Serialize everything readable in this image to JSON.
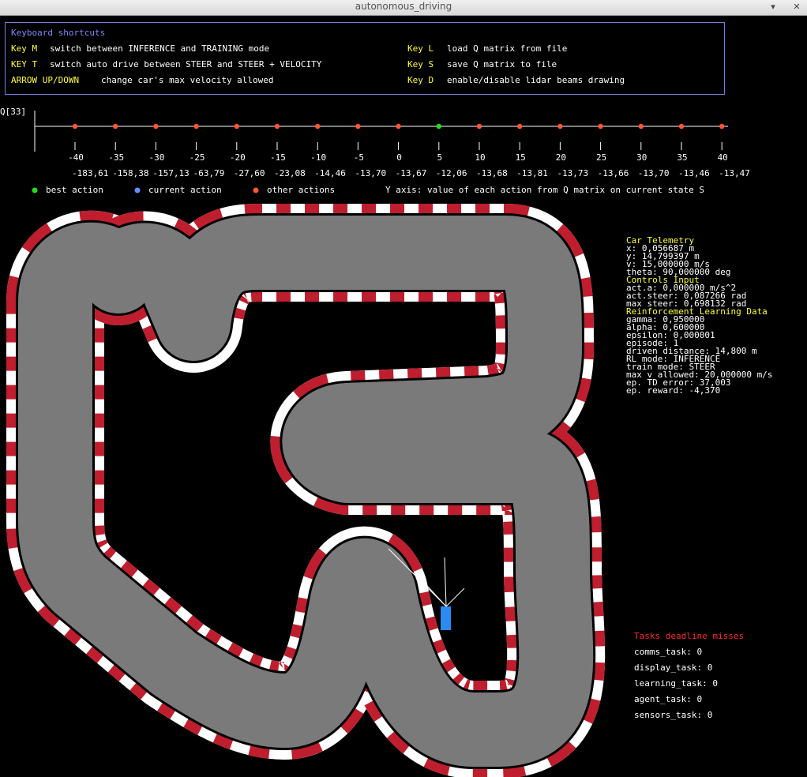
{
  "window": {
    "title": "autonomous_driving"
  },
  "shortcuts": {
    "header": "Keyboard shortcuts",
    "items": [
      {
        "key": "Key M",
        "desc": "switch between INFERENCE and TRAINING mode"
      },
      {
        "key": "KEY T",
        "desc": "switch auto drive between STEER and STEER + VELOCITY"
      },
      {
        "key": "ARROW UP/DOWN",
        "desc": "change car's max velocity allowed"
      },
      {
        "key": "Key L",
        "desc": "load Q matrix from file"
      },
      {
        "key": "Key S",
        "desc": "save Q matrix to file"
      },
      {
        "key": "Key D",
        "desc": "enable/disable lidar beams drawing"
      }
    ]
  },
  "qplot": {
    "label": "Q[33]",
    "actions": [
      "-40",
      "-35",
      "-30",
      "-25",
      "-20",
      "-15",
      "-10",
      "-5",
      "0",
      "5",
      "10",
      "15",
      "20",
      "25",
      "30",
      "35",
      "40"
    ],
    "values": [
      "-183,61",
      "-158,38",
      "-157,13",
      "-63,79",
      "-27,60",
      "-23,08",
      "-14,46",
      "-13,70",
      "-13,67",
      "-12,06",
      "-13,68",
      "-13,81",
      "-13,73",
      "-13,66",
      "-13,70",
      "-13,46",
      "-13,47"
    ],
    "best_index": 9,
    "legend": {
      "best": "best action",
      "current": "current action",
      "other": "other actions",
      "yaxis": "Y axis: value of each action from Q matrix on current state S"
    },
    "colors": {
      "best": "#22dd22",
      "current": "#6a8cff",
      "other": "#ff5533"
    }
  },
  "telemetry": {
    "car_header": "Car Telemetry",
    "car": [
      "x: 0,056687 m",
      "y: 14,799397 m",
      "v: 15,000000 m/s",
      "theta: 90,000000 deg"
    ],
    "controls_header": "Controls Input",
    "controls": [
      "act.a: 0,000000 m/s^2",
      "act.steer: 0,087266 rad",
      "max steer: 0,698132 rad"
    ],
    "rl_header": "Reinforcement Learning Data",
    "rl": [
      "gamma: 0,950000",
      "alpha: 0,600000",
      "epsilon: 0,000001",
      "episode: 1",
      "driven distance: 14,800 m",
      "RL mode: INFERENCE",
      "train mode: STEER",
      "max v allowed: 20,000000 m/s",
      "ep. TD error: 37,003",
      "ep. reward: -4,370"
    ]
  },
  "deadlines": {
    "header": "Tasks deadline misses",
    "items": [
      "comms_task: 0",
      "display_task: 0",
      "learning_task: 0",
      "agent_task: 0",
      "sensors_task: 0"
    ]
  },
  "colors": {
    "track": "#7a7a7a",
    "curb_red": "#bf1e2e",
    "curb_white": "#ffffff",
    "car": "#2a8cf0"
  }
}
